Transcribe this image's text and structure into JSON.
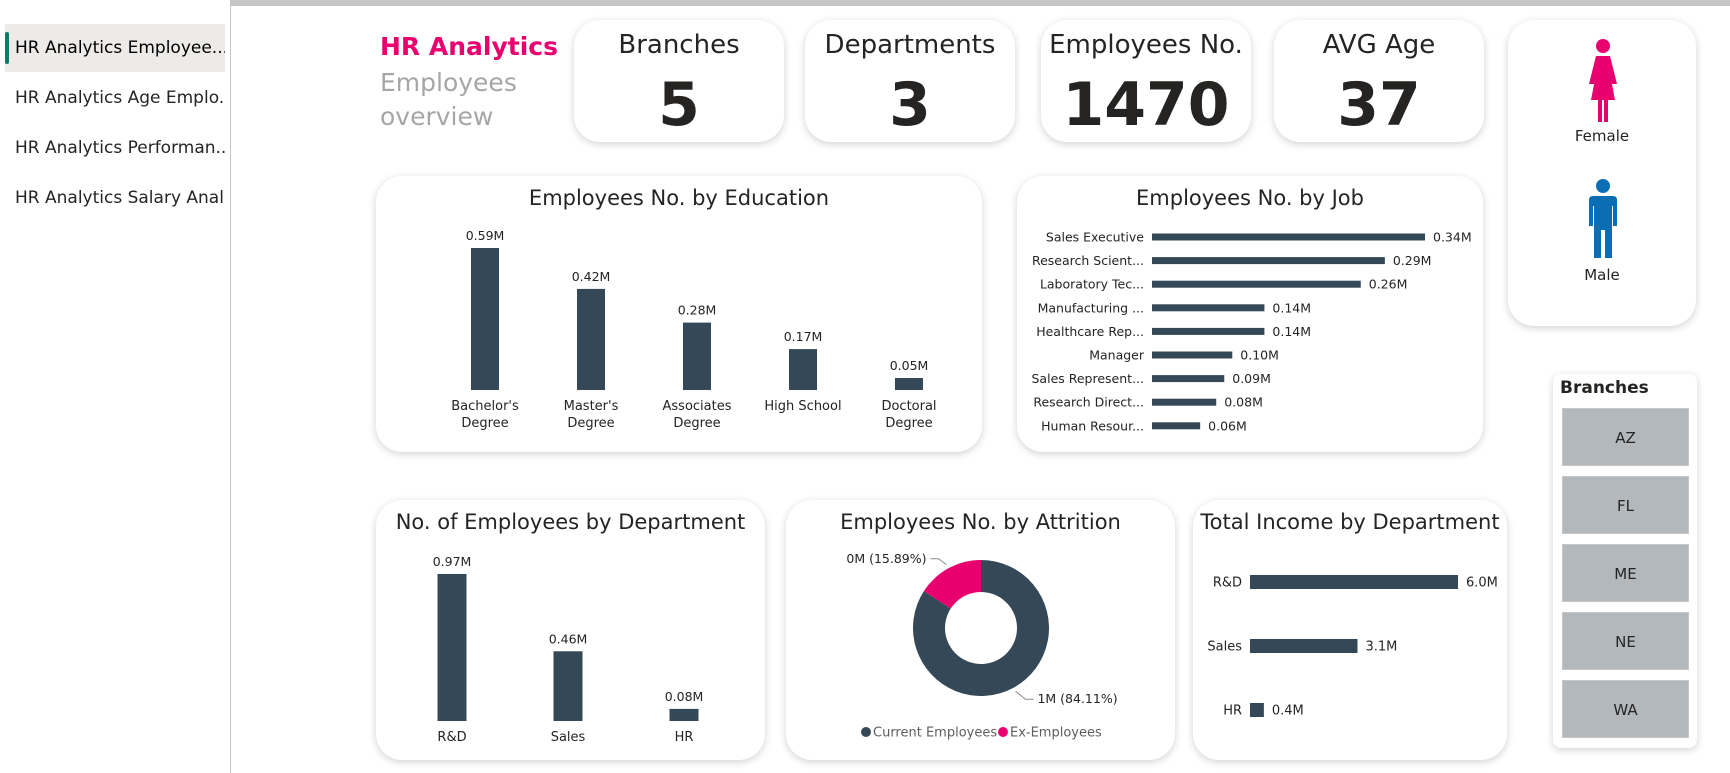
{
  "sidebar": {
    "pages": [
      {
        "label": "HR Analytics Employee..."
      },
      {
        "label": "HR Analytics Age Emplo..."
      },
      {
        "label": "HR Analytics Performan..."
      },
      {
        "label": "HR Analytics Salary Anal..."
      }
    ]
  },
  "header": {
    "title": "HR Analytics",
    "subtitle_line1": "Employees",
    "subtitle_line2": "overview"
  },
  "kpis": [
    {
      "title": "Branches",
      "value": "5"
    },
    {
      "title": "Departments",
      "value": "3"
    },
    {
      "title": "Employees No.",
      "value": "1470"
    },
    {
      "title": "AVG Age",
      "value": "37"
    }
  ],
  "gender": {
    "female": "Female",
    "male": "Male",
    "female_icon": "female-person-icon",
    "male_icon": "male-person-icon"
  },
  "branches": {
    "title": "Branches",
    "items": [
      "AZ",
      "FL",
      "ME",
      "NE",
      "WA"
    ]
  },
  "colors": {
    "bar": "#344857",
    "accent": "#e8006e",
    "female": "#e8006e",
    "male": "#0a6eb4",
    "slicer": "#b3b8bd"
  },
  "chart_data": [
    {
      "id": "education",
      "type": "bar",
      "title": "Employees No. by Education",
      "categories": [
        "Bachelor's Degree",
        "Master's Degree",
        "Associates Degree",
        "High School",
        "Doctoral Degree"
      ],
      "values": [
        0.59,
        0.42,
        0.28,
        0.17,
        0.05
      ],
      "labels": [
        "0.59M",
        "0.42M",
        "0.28M",
        "0.17M",
        "0.05M"
      ]
    },
    {
      "id": "job",
      "type": "bar",
      "orientation": "horizontal",
      "title": "Employees No. by Job",
      "categories": [
        "Sales Executive",
        "Research Scient...",
        "Laboratory Tec...",
        "Manufacturing ...",
        "Healthcare Rep...",
        "Manager",
        "Sales Represent...",
        "Research Direct...",
        "Human Resour..."
      ],
      "values": [
        0.34,
        0.29,
        0.26,
        0.14,
        0.14,
        0.1,
        0.09,
        0.08,
        0.06
      ],
      "labels": [
        "0.34M",
        "0.29M",
        "0.26M",
        "0.14M",
        "0.14M",
        "0.10M",
        "0.09M",
        "0.08M",
        "0.06M"
      ]
    },
    {
      "id": "department",
      "type": "bar",
      "title": "No. of Employees by Department",
      "categories": [
        "R&D",
        "Sales",
        "HR"
      ],
      "values": [
        0.97,
        0.46,
        0.08
      ],
      "labels": [
        "0.97M",
        "0.46M",
        "0.08M"
      ]
    },
    {
      "id": "attrition",
      "type": "pie",
      "title": "Employees No. by Attrition",
      "categories": [
        "Current Employees",
        "Ex-Employees"
      ],
      "values": [
        84.11,
        15.89
      ],
      "labels": [
        "1M (84.11%)",
        "0M (15.89%)"
      ],
      "legend": [
        "Current Employees",
        "Ex-Employees"
      ]
    },
    {
      "id": "income",
      "type": "bar",
      "orientation": "horizontal",
      "title": "Total Income by Department",
      "categories": [
        "R&D",
        "Sales",
        "HR"
      ],
      "values": [
        6.0,
        3.1,
        0.4
      ],
      "labels": [
        "6.0M",
        "3.1M",
        "0.4M"
      ]
    }
  ]
}
